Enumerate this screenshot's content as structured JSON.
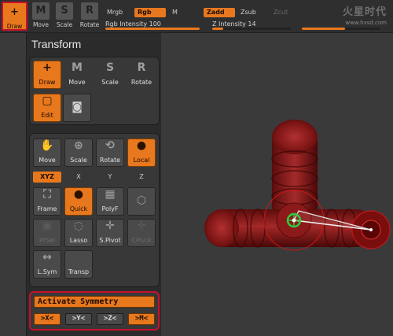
{
  "toolbar": {
    "tools": [
      {
        "label": "Draw",
        "glyph": "+"
      },
      {
        "label": "Move",
        "glyph": "M"
      },
      {
        "label": "Scale",
        "glyph": "S"
      },
      {
        "label": "Rotate",
        "glyph": "R"
      }
    ],
    "modes": {
      "mrgb": "Mrgb",
      "rgb": "Rgb",
      "m": "M",
      "zadd": "Zadd",
      "zsub": "Zsub",
      "zcut": "Zcut"
    },
    "rgb_intensity_label": "Rgb Intensity 100",
    "rgb_intensity_level": 1.0,
    "z_intensity_label": "Z Intensity 14",
    "z_intensity_level": 0.14,
    "third_slider_level": 0.55
  },
  "watermark": {
    "title": "火星时代",
    "url": "www.hxsd.com"
  },
  "palette": {
    "title": "Transform",
    "top_group": [
      {
        "label": "Draw",
        "glyph": "+"
      },
      {
        "label": "Move",
        "glyph": "M"
      },
      {
        "label": "Scale",
        "glyph": "S"
      },
      {
        "label": "Rotate",
        "glyph": "R"
      },
      {
        "label": "Edit",
        "glyph": "▢"
      },
      {
        "label": "",
        "glyph": "◙"
      }
    ],
    "nav_group": [
      {
        "label": "Move",
        "glyph": "✋"
      },
      {
        "label": "Scale",
        "glyph": "⊕"
      },
      {
        "label": "Rotate",
        "glyph": "⟲"
      },
      {
        "label": "Local",
        "glyph": "●"
      }
    ],
    "axis_row": {
      "xyz": "XYZ",
      "x": "X",
      "y": "Y",
      "z": "Z"
    },
    "row3": [
      {
        "label": "Frame",
        "glyph": "⛶"
      },
      {
        "label": "Quick",
        "glyph": "●"
      },
      {
        "label": "PolyF",
        "glyph": "▦"
      },
      {
        "label": "",
        "glyph": "⬡"
      }
    ],
    "row4": [
      {
        "label": "PtSel",
        "glyph": "▣"
      },
      {
        "label": "Lasso",
        "glyph": "◌"
      },
      {
        "label": "S.Pivot",
        "glyph": "✛"
      },
      {
        "label": "CPivot",
        "glyph": "✛"
      }
    ],
    "row5": [
      {
        "label": "L.Sym",
        "glyph": "↔"
      },
      {
        "label": "Transp",
        "glyph": ""
      }
    ],
    "symmetry": {
      "activate_label": "Activate Symmetry",
      "x": ">X<",
      "y": ">Y<",
      "z": ">Z<",
      "m": ">M<"
    }
  },
  "colors": {
    "accent": "#e8781e",
    "highlight_border": "#c8102e",
    "model": "#8a1818",
    "gizmo_green": "#2ecc40"
  }
}
